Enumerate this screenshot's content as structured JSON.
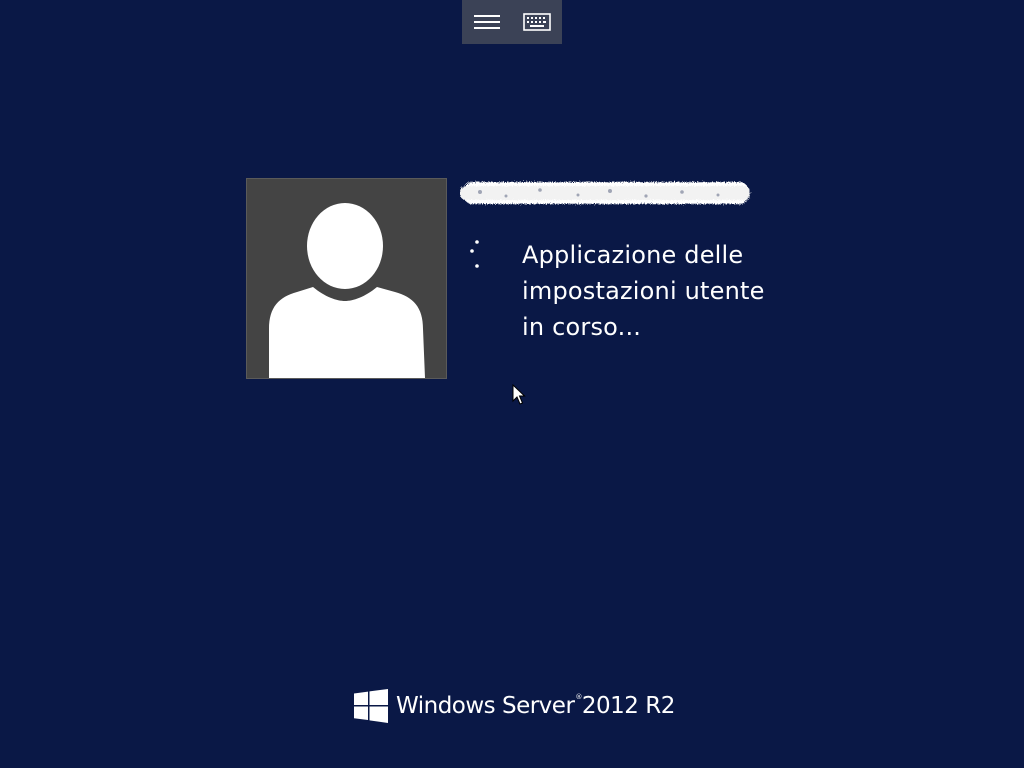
{
  "toolbar": {
    "menu_icon": "hamburger-menu-icon",
    "keyboard_icon": "keyboard-icon"
  },
  "user": {
    "avatar_icon": "default-user-avatar-icon",
    "name_redacted": true
  },
  "status": {
    "message": "Applicazione delle impostazioni utente in corso..."
  },
  "branding": {
    "logo_icon": "windows-logo-icon",
    "product_name": "Windows Server",
    "trademark": "®",
    "version": "2012 R2"
  },
  "colors": {
    "background": "#0a1846",
    "toolbar": "#3b4256",
    "avatar_bg": "#444444",
    "text": "#ffffff"
  }
}
